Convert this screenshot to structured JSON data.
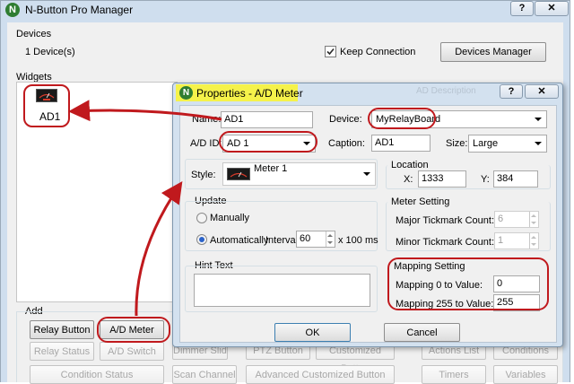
{
  "main": {
    "title": "N-Button Pro Manager",
    "logo_letter": "N",
    "devices_label": "Devices",
    "device_count": "1 Device(s)",
    "keep_connection_label": "Keep Connection",
    "keep_connection_checked": true,
    "devices_manager_button": "Devices Manager",
    "widgets_label": "Widgets",
    "widget_item_label": "AD1",
    "add_label": "Add",
    "add_buttons_row1": [
      "Relay Button",
      "A/D Meter",
      "Dimmer Slider",
      "PTZ Button",
      "Customized Button",
      "Actions List",
      "Conditions"
    ],
    "add_buttons_row2": [
      "Relay Status",
      "A/D Switch"
    ],
    "add_buttons_row3": [
      "Condition Status",
      "Scan Channel",
      "Advanced Customized Button",
      "Timers",
      "Variables"
    ],
    "behind_column_header": "AD Description"
  },
  "dialog": {
    "title": "Properties - A/D Meter",
    "logo_letter": "N",
    "name_label": "Name:",
    "name_value": "AD1",
    "device_label": "Device:",
    "device_value": "MyRelayBoard",
    "adid_label": "A/D ID:",
    "adid_value": "AD 1",
    "caption_label": "Caption:",
    "caption_value": "AD1",
    "size_label": "Size:",
    "size_value": "Large",
    "style_label": "Style:",
    "style_value": "Meter 1",
    "location_label": "Location",
    "x_label": "X:",
    "x_value": "1333",
    "y_label": "Y:",
    "y_value": "384",
    "update_label": "Update",
    "manually_label": "Manually",
    "automatically_label": "Automatically",
    "update_mode": "automatically",
    "interval_label": "Interval:",
    "interval_value": "60",
    "interval_unit": "x 100 ms",
    "meter_setting_label": "Meter Setting",
    "major_tick_label": "Major Tickmark Count:",
    "major_tick_value": "6",
    "minor_tick_label": "Minor Tickmark Count:",
    "minor_tick_value": "1",
    "hint_text_label": "Hint Text",
    "hint_text_value": "",
    "mapping_setting_label": "Mapping Setting",
    "mapping0_label": "Mapping 0 to Value:",
    "mapping0_value": "0",
    "mapping255_label": "Mapping 255 to Value:",
    "mapping255_value": "255",
    "ok_button": "OK",
    "cancel_button": "Cancel",
    "help_glyph": "?",
    "close_glyph": "✕"
  },
  "colors": {
    "annotation_red": "#c0191d",
    "title_highlight": "#f5f24a",
    "window_frame": "#cfdeee",
    "logo_green": "#2f7d31"
  }
}
